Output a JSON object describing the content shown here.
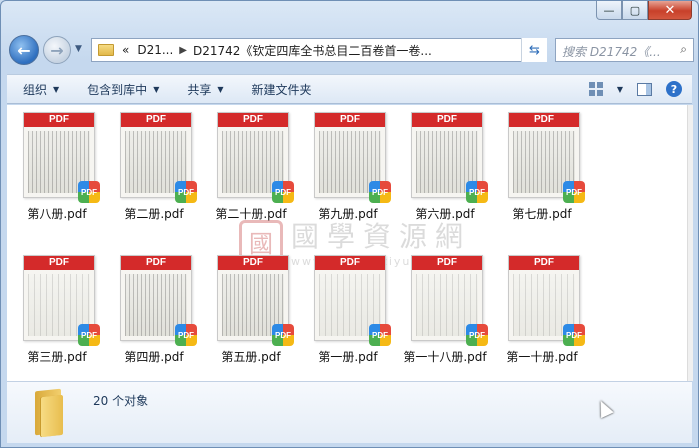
{
  "window": {
    "caption_buttons": {
      "minimize": "—",
      "maximize": "▢",
      "close": "✕"
    }
  },
  "nav": {
    "back_glyph": "←",
    "forward_glyph": "→",
    "address": {
      "prefix": "«",
      "crumbs": [
        "D21...",
        "D21742《钦定四库全书总目二百卷首一卷..."
      ]
    },
    "search_placeholder": "搜索 D21742《..."
  },
  "toolbar": {
    "items": [
      "组织",
      "包含到库中",
      "共享",
      "新建文件夹"
    ]
  },
  "files": [
    {
      "name": "第八册.pdf",
      "thumb_label": "PDF",
      "badge": "PDF",
      "style": "dense"
    },
    {
      "name": "第二册.pdf",
      "thumb_label": "PDF",
      "badge": "PDF",
      "style": "dense"
    },
    {
      "name": "第二十册.pdf",
      "thumb_label": "PDF",
      "badge": "PDF",
      "style": "dense"
    },
    {
      "name": "第九册.pdf",
      "thumb_label": "PDF",
      "badge": "PDF",
      "style": "dense"
    },
    {
      "name": "第六册.pdf",
      "thumb_label": "PDF",
      "badge": "PDF",
      "style": "dense"
    },
    {
      "name": "第七册.pdf",
      "thumb_label": "PDF",
      "badge": "PDF",
      "style": "dense"
    },
    {
      "name": "第三册.pdf",
      "thumb_label": "PDF",
      "badge": "PDF",
      "style": "light"
    },
    {
      "name": "第四册.pdf",
      "thumb_label": "PDF",
      "badge": "PDF",
      "style": "dense"
    },
    {
      "name": "第五册.pdf",
      "thumb_label": "PDF",
      "badge": "PDF",
      "style": "dense"
    },
    {
      "name": "第一册.pdf",
      "thumb_label": "PDF",
      "badge": "PDF",
      "style": "light"
    },
    {
      "name": "第一十八册.pdf",
      "thumb_label": "PDF",
      "badge": "PDF",
      "style": "light"
    },
    {
      "name": "第一十册.pdf",
      "thumb_label": "PDF",
      "badge": "PDF",
      "style": "light"
    }
  ],
  "watermark": {
    "seal": "國",
    "title": "國學資源網",
    "url": "www.guoxueziyuan.com"
  },
  "status": {
    "count_text": "20 个对象"
  }
}
